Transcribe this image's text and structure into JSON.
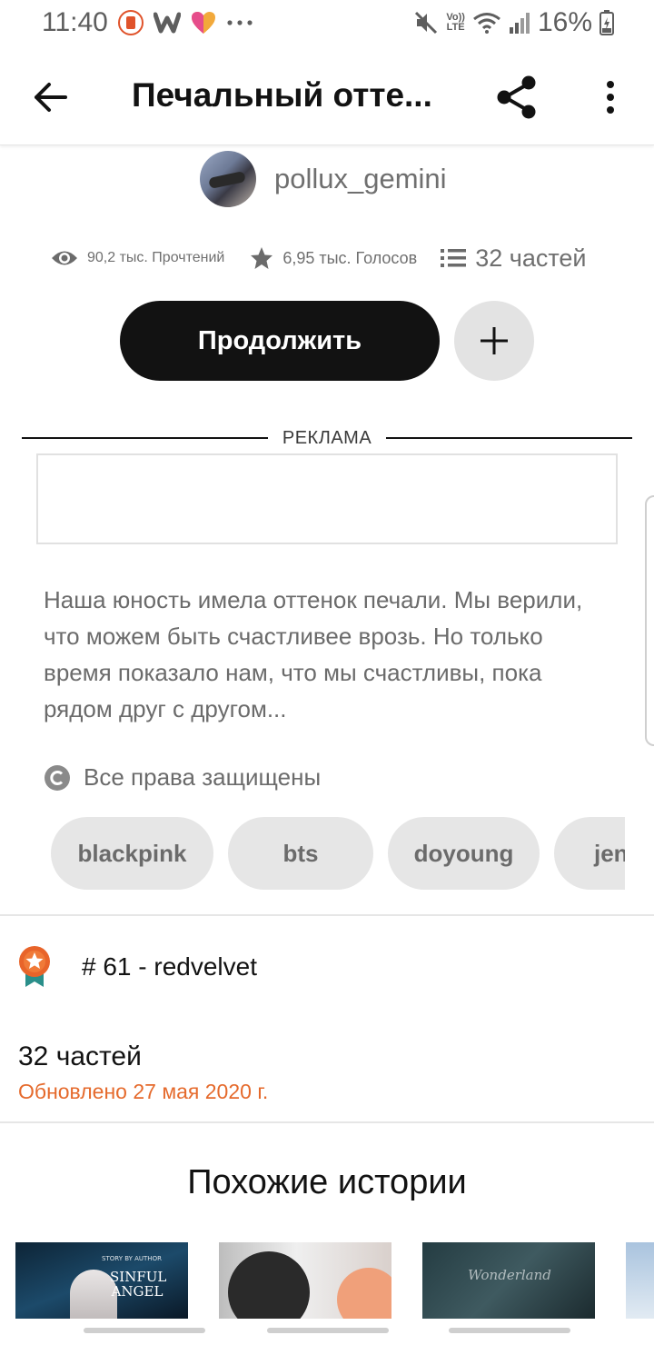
{
  "status_bar": {
    "time": "11:40",
    "network": "LTE",
    "battery": "16%",
    "notification_icons": [
      "app-notification-icon",
      "wattpad-icon",
      "heart-app-icon",
      "more-notifications-icon"
    ],
    "system_icons": [
      "mute-icon",
      "volte-icon",
      "wifi-icon",
      "signal-icon",
      "battery-icon"
    ]
  },
  "app_bar": {
    "title": "Печальный отте...",
    "icons": [
      "back-arrow-icon",
      "share-icon",
      "more-vert-icon"
    ]
  },
  "story": {
    "author": "pollux_gemini",
    "reads": "90,2 тыс. Прочтений",
    "votes": "6,95 тыс. Голосов",
    "parts": "32 частей",
    "continue_label": "Продолжить",
    "ad_label": "РЕКЛАМА",
    "description": "Наша юность имела оттенок печали. Мы верили, что можем быть счастливее врозь. Но только время показало нам, что мы счастливы, пока рядом друг с другом...",
    "copyright": "Все права защищены",
    "tags": [
      "blackpink",
      "bts",
      "doyoung",
      "jen"
    ],
    "ranking": "# 61 - redvelvet",
    "parts_count": "32 частей",
    "updated": "Обновлено 27 мая 2020 г."
  },
  "similar": {
    "title": "Похожие истории",
    "covers": [
      {
        "text": "SINFUL ANGEL",
        "text_top": "STORY BY AUTHOR"
      },
      {
        "text": ""
      },
      {
        "text": "Wonderland"
      },
      {
        "text": ""
      }
    ]
  },
  "colors": {
    "primary_text": "#121212",
    "secondary_text": "#6b6b6b",
    "accent_orange": "#e56a2c",
    "tag_background": "#e6e6e6",
    "button_dark": "#121212"
  }
}
